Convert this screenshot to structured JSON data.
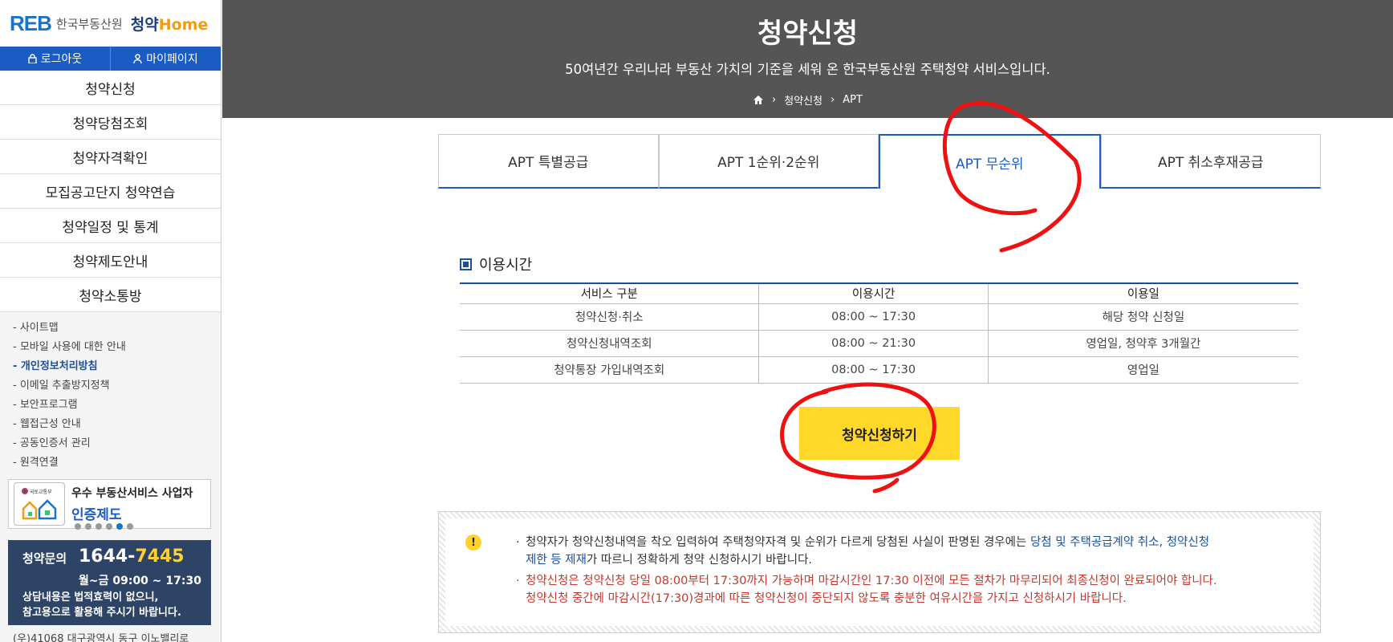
{
  "sidebar": {
    "logo": {
      "reb": "REB",
      "org": "한국부동산원",
      "home_prefix": "청약",
      "home_suffix": "Home"
    },
    "account": [
      {
        "label": "로그아웃",
        "icon": "lock-icon"
      },
      {
        "label": "마이페이지",
        "icon": "person-icon"
      }
    ],
    "menu": [
      "청약신청",
      "청약당첨조회",
      "청약자격확인",
      "모집공고단지 청약연습",
      "청약일정 및 통계",
      "청약제도안내",
      "청약소통방"
    ],
    "links": [
      "- 사이트맵",
      "- 모바일 사용에 대한 안내",
      "- 개인정보처리방침",
      "- 이메일 추출방지정책",
      "- 보안프로그램",
      "- 웹접근성 안내",
      "- 공동인증서 관리",
      "- 원격연결"
    ],
    "active_link_index": 2,
    "certification": {
      "line1": "우수 부동산서비스 사업자",
      "line2": "인증제도",
      "seal_text": "국토교통부"
    },
    "contact": {
      "title": "청약문의",
      "number_prefix": "1644-",
      "number_suffix": "7445",
      "hours": "월~금 09:00 ~ 17:30",
      "note_line1": "상담내용은 법적효력이 없으니,",
      "note_line2": "참고용으로 활용해 주시기 바랍니다."
    },
    "address": "(우)41068 대구광역시 동구 이노밸리로"
  },
  "hero": {
    "title": "청약신청",
    "subtitle": "50여년간 우리나라 부동산 가치의 기준을 세워 온 한국부동산원 주택청약 서비스입니다.",
    "breadcrumb": [
      "청약신청",
      "APT"
    ]
  },
  "tabs": [
    "APT 특별공급",
    "APT 1순위·2순위",
    "APT 무순위",
    "APT 취소후재공급"
  ],
  "active_tab_index": 2,
  "usage": {
    "title": "이용시간",
    "headers": [
      "서비스 구분",
      "이용시간",
      "이용일"
    ],
    "rows": [
      [
        "청약신청·취소",
        "08:00 ~ 17:30",
        "해당 청약 신청일"
      ],
      [
        "청약신청내역조회",
        "08:00 ~ 21:30",
        "영업일, 청약후 3개월간"
      ],
      [
        "청약통장 가입내역조회",
        "08:00 ~ 17:30",
        "영업일"
      ]
    ]
  },
  "apply_button": "청약신청하기",
  "notice": {
    "icon": "!",
    "line1_a": "청약자가 청약신청내역을 착오 입력하여 주택청약자격 및 순위가 다르게 당첨된 사실이 판명된 경우에는 ",
    "line1_b": "당첨 및 주택공급계약 취소, 청약신청",
    "line2_a": "제한 등 제재",
    "line2_b": "가 따르니 정확하게 청약 신청하시기 바랍니다.",
    "line3": "청약신청은 청약신청 당일 08:00부터 17:30까지 가능하며 마감시간인 17:30 이전에 모든 절차가 마무리되어 최종신청이 완료되어야 합니다.",
    "line4": "청약신청 중간에 마감시간(17:30)경과에 따른 청약신청이 중단되지 않도록 충분한 여유시간을 가지고 신청하시기 바랍니다."
  },
  "colors": {
    "primary": "#1a5bc4",
    "hero_bg": "#555555",
    "button": "#ffd829",
    "annotation": "#ee1111"
  }
}
